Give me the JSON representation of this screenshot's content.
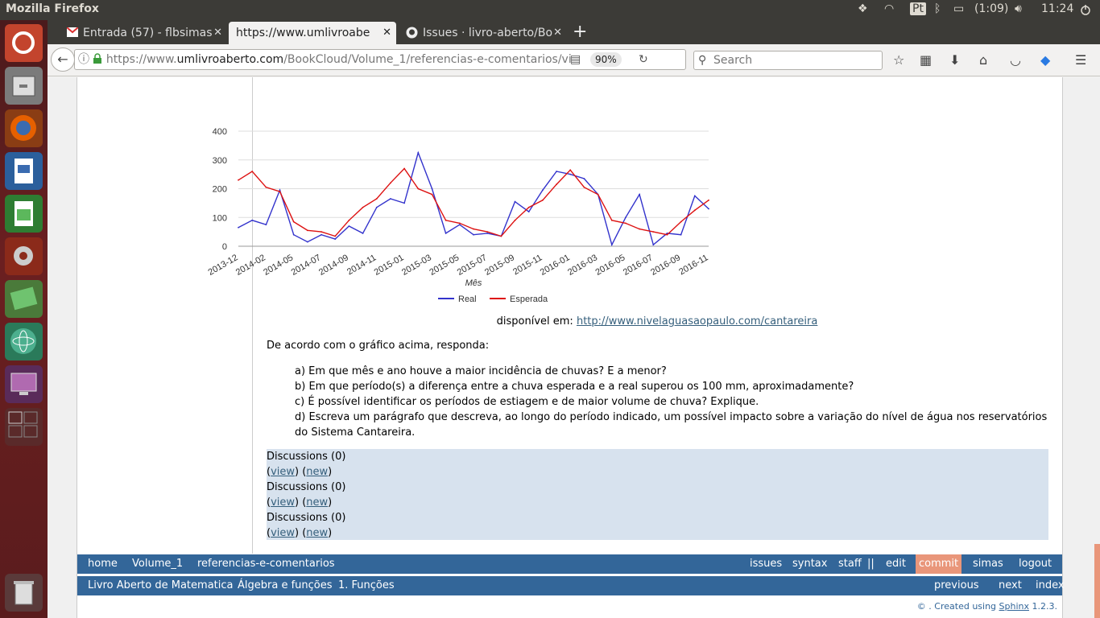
{
  "window": {
    "title": "Mozilla Firefox"
  },
  "tray": {
    "lang": "Pt",
    "battery": "(1:09)",
    "clock": "11:24"
  },
  "tabs": [
    {
      "label": "Entrada (57) - flbsimas",
      "close": "✕"
    },
    {
      "label": "https://www.umlivroabe",
      "close": "✕"
    },
    {
      "label": "Issues · livro-aberto/Bo",
      "close": "✕"
    }
  ],
  "new_tab": "+",
  "nav": {
    "url_prefix": "https://www.",
    "url_host": "umlivroaberto.com",
    "url_path": "/BookCloud/Volume_1/referencias-e-comentarios/vi",
    "zoom": "90%",
    "search_placeholder": "Search"
  },
  "chart_data": {
    "type": "line",
    "xlabel": "Mês",
    "ylim": [
      0,
      400
    ],
    "yticks": [
      "0",
      "100",
      "200",
      "300",
      "400"
    ],
    "x_tick_labels": [
      "2013-12",
      "2014-02",
      "2014-05",
      "2014-07",
      "2014-09",
      "2014-11",
      "2015-01",
      "2015-03",
      "2015-05",
      "2015-07",
      "2015-09",
      "2015-11",
      "2016-01",
      "2016-03",
      "2016-05",
      "2016-07",
      "2016-09",
      "2016-11"
    ],
    "legend": "bottom",
    "series": [
      {
        "name": "Real",
        "color": "#3333cc",
        "values": [
          65,
          90,
          75,
          195,
          40,
          15,
          40,
          25,
          70,
          45,
          135,
          165,
          150,
          325,
          200,
          45,
          75,
          40,
          45,
          35,
          155,
          120,
          195,
          260,
          250,
          235,
          180,
          5,
          100,
          180,
          5,
          45,
          40,
          175,
          130
        ]
      },
      {
        "name": "Esperada",
        "color": "#dd1111",
        "values": [
          230,
          260,
          205,
          190,
          85,
          55,
          50,
          35,
          90,
          135,
          165,
          220,
          270,
          200,
          180,
          90,
          80,
          60,
          50,
          35,
          90,
          135,
          160,
          215,
          265,
          205,
          180,
          90,
          80,
          60,
          50,
          40,
          85,
          125,
          160
        ]
      }
    ]
  },
  "caption": {
    "prefix": "disponível em: ",
    "link": "http://www.nivelaguasaopaulo.com/cantareira"
  },
  "intro": "De acordo com o gráfico acima, responda:",
  "questions": [
    "a) Em que mês e ano houve a maior incidência de chuvas? E a menor?",
    "b) Em que período(s) a diferença entre a chuva esperada e a real superou os 100 mm, aproximadamente?",
    "c) É possível identificar os períodos de estiagem e de maior volume de chuva? Explique.",
    "d) Escreva um parágrafo que descreva, ao longo do período indicado, um possível impacto sobre a variação do nível de água nos reservatórios do Sistema Cantareira."
  ],
  "discussions": {
    "title": "Discussions (0)",
    "view": "view",
    "new": "new"
  },
  "relbar1": {
    "home": "home",
    "volume": "Volume_1",
    "page": "referencias-e-comentarios",
    "issues": "issues",
    "syntax": "syntax",
    "staff": "staff",
    "sep": "||",
    "edit": "edit",
    "commit": "commit",
    "user": "simas",
    "logout": "logout"
  },
  "relbar2": {
    "book": "Livro Aberto de Matematica",
    "chapter": "Álgebra e funções",
    "section": "1. Funções",
    "previous": "previous",
    "next": "next",
    "index": "index"
  },
  "footer": {
    "text": "© . Created using ",
    "sphinx": "Sphinx",
    "version": " 1.2.3."
  }
}
